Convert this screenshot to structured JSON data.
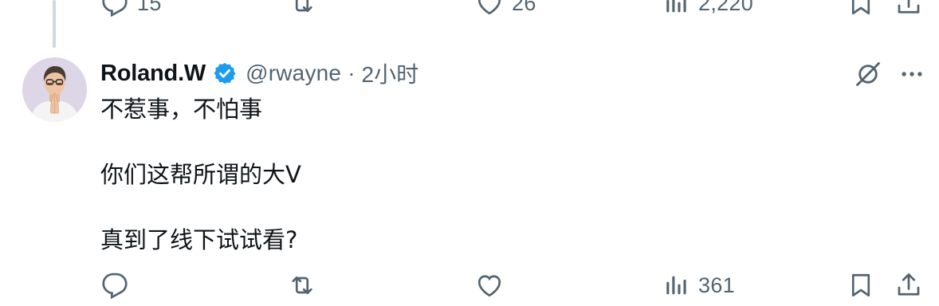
{
  "previous_tweet": {
    "actions": {
      "reply_count": "15",
      "like_count": "26",
      "view_count": "2,220"
    }
  },
  "tweet": {
    "author_name": "Roland.W",
    "verified": true,
    "handle": "@rwayne",
    "separator": "·",
    "timestamp": "2小时",
    "lines": [
      "不惹事，不怕事",
      "你们这帮所谓的大V",
      "真到了线下试试看?"
    ],
    "actions": {
      "view_count": "361"
    }
  },
  "icons": {
    "reply": "reply-icon",
    "retweet": "retweet-icon",
    "like": "heart-icon",
    "views": "views-icon",
    "bookmark": "bookmark-icon",
    "share": "share-icon",
    "grok": "grok-icon",
    "more": "more-icon",
    "verified": "verified-badge-icon"
  },
  "colors": {
    "text": "#0f1419",
    "secondary": "#536471",
    "verified_blue": "#1d9bf0",
    "thread_line": "#cfd9de"
  }
}
